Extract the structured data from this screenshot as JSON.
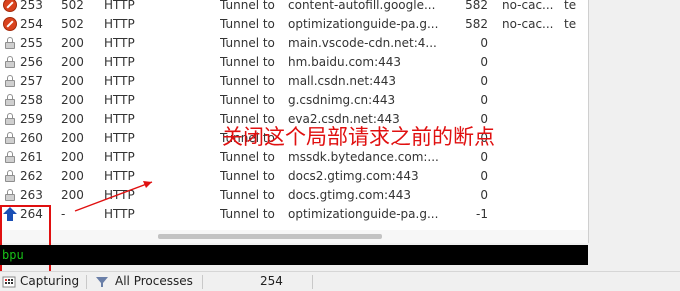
{
  "sessions": [
    {
      "num": "253",
      "result": "502",
      "protocol": "HTTP",
      "host": "Tunnel to",
      "url": "content-autofill.google...",
      "body": "582",
      "caching": "no-cac...",
      "ctype": "te",
      "icon": "error-icon"
    },
    {
      "num": "254",
      "result": "502",
      "protocol": "HTTP",
      "host": "Tunnel to",
      "url": "optimizationguide-pa.g...",
      "body": "582",
      "caching": "no-cac...",
      "ctype": "te",
      "icon": "error-icon"
    },
    {
      "num": "255",
      "result": "200",
      "protocol": "HTTP",
      "host": "Tunnel to",
      "url": "main.vscode-cdn.net:4...",
      "body": "0",
      "caching": "",
      "ctype": "",
      "icon": "lock-icon"
    },
    {
      "num": "256",
      "result": "200",
      "protocol": "HTTP",
      "host": "Tunnel to",
      "url": "hm.baidu.com:443",
      "body": "0",
      "caching": "",
      "ctype": "",
      "icon": "lock-icon"
    },
    {
      "num": "257",
      "result": "200",
      "protocol": "HTTP",
      "host": "Tunnel to",
      "url": "mall.csdn.net:443",
      "body": "0",
      "caching": "",
      "ctype": "",
      "icon": "lock-icon"
    },
    {
      "num": "258",
      "result": "200",
      "protocol": "HTTP",
      "host": "Tunnel to",
      "url": "g.csdnimg.cn:443",
      "body": "0",
      "caching": "",
      "ctype": "",
      "icon": "lock-icon"
    },
    {
      "num": "259",
      "result": "200",
      "protocol": "HTTP",
      "host": "Tunnel to",
      "url": "eva2.csdn.net:443",
      "body": "0",
      "caching": "",
      "ctype": "",
      "icon": "lock-icon"
    },
    {
      "num": "260",
      "result": "200",
      "protocol": "HTTP",
      "host": "Tunnel to",
      "url": "",
      "body": "0",
      "caching": "",
      "ctype": "",
      "icon": "lock-icon"
    },
    {
      "num": "261",
      "result": "200",
      "protocol": "HTTP",
      "host": "Tunnel to",
      "url": "mssdk.bytedance.com:...",
      "body": "0",
      "caching": "",
      "ctype": "",
      "icon": "lock-icon"
    },
    {
      "num": "262",
      "result": "200",
      "protocol": "HTTP",
      "host": "Tunnel to",
      "url": "docs2.gtimg.com:443",
      "body": "0",
      "caching": "",
      "ctype": "",
      "icon": "lock-icon"
    },
    {
      "num": "263",
      "result": "200",
      "protocol": "HTTP",
      "host": "Tunnel to",
      "url": "docs.gtimg.com:443",
      "body": "0",
      "caching": "",
      "ctype": "",
      "icon": "lock-icon"
    },
    {
      "num": "264",
      "result": "-",
      "protocol": "HTTP",
      "host": "Tunnel to",
      "url": "optimizationguide-pa.g...",
      "body": "-1",
      "caching": "",
      "ctype": "",
      "icon": "breakpoint-up-arrow-icon"
    }
  ],
  "annotation": {
    "text": "关闭这个局部请求之前的断点",
    "color": "#e01010"
  },
  "quickexec": {
    "value": "bpu",
    "text_color": "#18c018"
  },
  "statusbar": {
    "capturing": "Capturing",
    "processes": "All Processes",
    "count": "254"
  },
  "colors": {
    "error": "#d9431e",
    "arrow_blue": "#1a4fb5",
    "annot_red": "#e01010"
  }
}
